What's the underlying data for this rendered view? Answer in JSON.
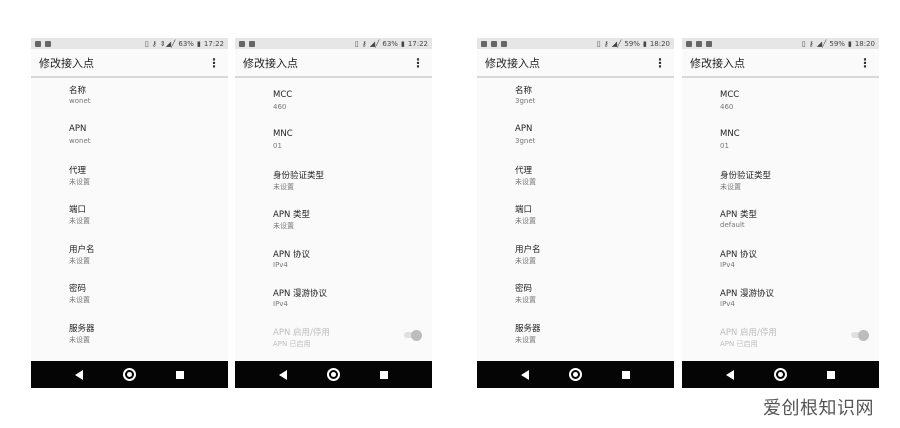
{
  "phones": [
    {
      "status": {
        "battery": "63%",
        "time": "17:22",
        "signal": "⇕◢╱"
      },
      "title": "修改接入点",
      "items": [
        {
          "label": "名称",
          "value": "wonet"
        },
        {
          "label": "APN",
          "value": "wonet"
        },
        {
          "label": "代理",
          "value": "未设置"
        },
        {
          "label": "端口",
          "value": "未设置"
        },
        {
          "label": "用户名",
          "value": "未设置"
        },
        {
          "label": "密码",
          "value": "未设置"
        },
        {
          "label": "服务器",
          "value": "未设置"
        }
      ]
    },
    {
      "status": {
        "battery": "63%",
        "time": "17:22",
        "signal": "◢╱"
      },
      "title": "修改接入点",
      "items": [
        {
          "label": "MCC",
          "value": "460"
        },
        {
          "label": "MNC",
          "value": "01"
        },
        {
          "label": "身份验证类型",
          "value": "未设置"
        },
        {
          "label": "APN 类型",
          "value": "未设置"
        },
        {
          "label": "APN 协议",
          "value": "IPv4"
        },
        {
          "label": "APN 漫游协议",
          "value": "IPv4"
        },
        {
          "label": "APN 启用/停用",
          "value": "APN 已启用"
        }
      ]
    },
    {
      "status": {
        "battery": "59%",
        "time": "18:20",
        "signal": "◢╱"
      },
      "title": "修改接入点",
      "items": [
        {
          "label": "名称",
          "value": "3gnet"
        },
        {
          "label": "APN",
          "value": "3gnet"
        },
        {
          "label": "代理",
          "value": "未设置"
        },
        {
          "label": "端口",
          "value": "未设置"
        },
        {
          "label": "用户名",
          "value": "未设置"
        },
        {
          "label": "密码",
          "value": "未设置"
        },
        {
          "label": "服务器",
          "value": "未设置"
        }
      ]
    },
    {
      "status": {
        "battery": "59%",
        "time": "18:20",
        "signal": "◢╱"
      },
      "title": "修改接入点",
      "items": [
        {
          "label": "MCC",
          "value": "460"
        },
        {
          "label": "MNC",
          "value": "01"
        },
        {
          "label": "身份验证类型",
          "value": "未设置"
        },
        {
          "label": "APN 类型",
          "value": "default"
        },
        {
          "label": "APN 协议",
          "value": "IPv4"
        },
        {
          "label": "APN 漫游协议",
          "value": "IPv4"
        },
        {
          "label": "APN 启用/停用",
          "value": "APN 已启用"
        }
      ]
    }
  ],
  "watermark": "爱创根知识网"
}
